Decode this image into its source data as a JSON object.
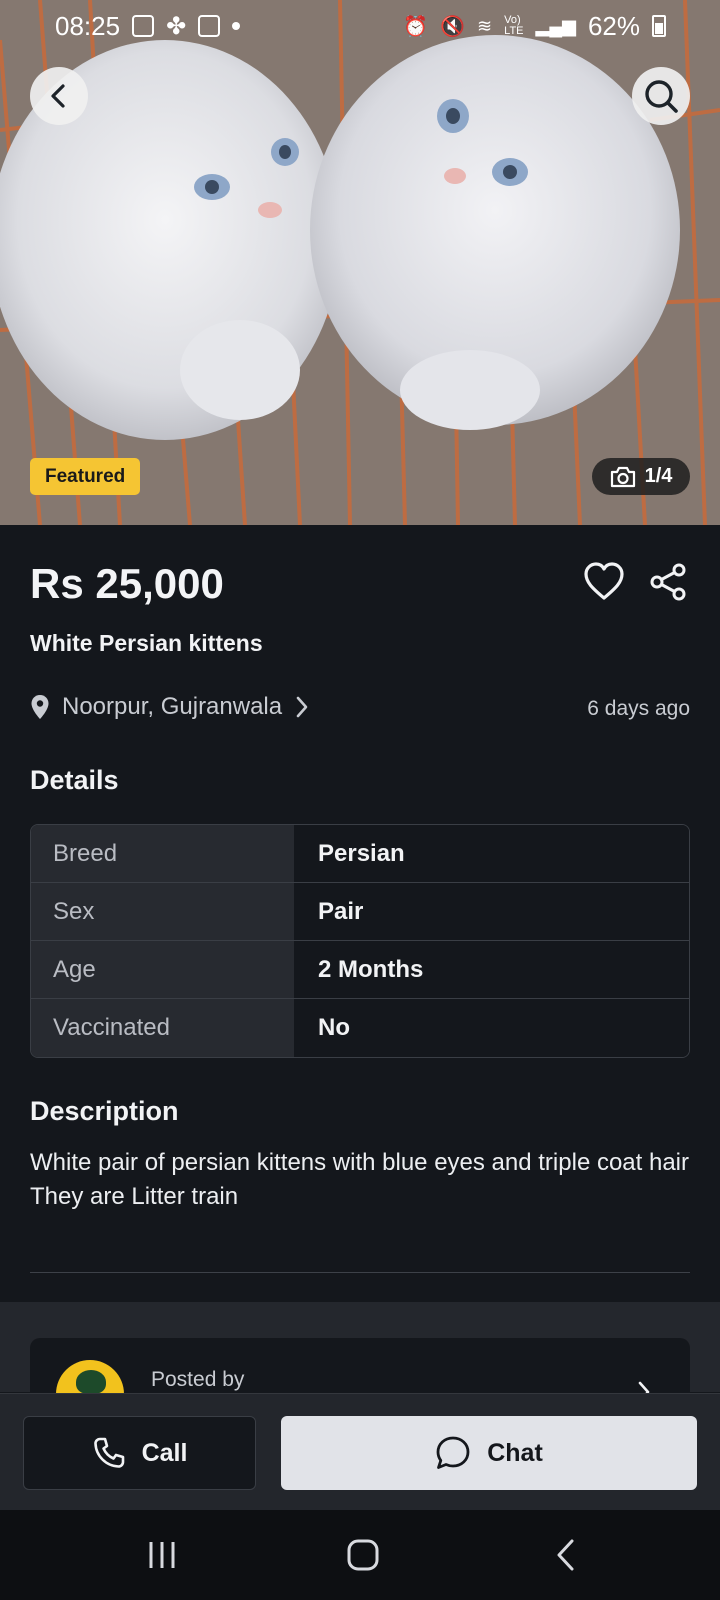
{
  "status_bar": {
    "time": "08:25",
    "battery": "62%"
  },
  "hero": {
    "image_counter": "1/4",
    "badge": "Featured"
  },
  "listing": {
    "price": "Rs 25,000",
    "title": "White Persian kittens",
    "location": "Noorpur, Gujranwala",
    "posted_ago": "6 days ago"
  },
  "details": {
    "heading": "Details",
    "rows": [
      {
        "key": "Breed",
        "value": "Persian"
      },
      {
        "key": "Sex",
        "value": "Pair"
      },
      {
        "key": "Age",
        "value": "2 Months"
      },
      {
        "key": "Vaccinated",
        "value": "No"
      }
    ]
  },
  "description": {
    "heading": "Description",
    "line1": "White pair of persian kittens with blue eyes and triple coat hair",
    "line2": "They are Litter train"
  },
  "seller": {
    "posted_by_label": "Posted by"
  },
  "actions": {
    "call_label": "Call",
    "chat_label": "Chat"
  },
  "colors": {
    "background": "#14171c",
    "featured_badge": "#f5c533",
    "chat_button": "#e1e3e8"
  }
}
